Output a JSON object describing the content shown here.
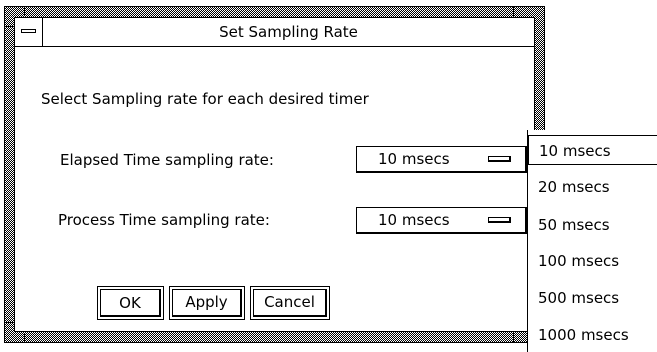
{
  "dialog": {
    "title": "Set Sampling Rate",
    "prompt": "Select Sampling rate for each desired timer"
  },
  "rows": [
    {
      "label": "Elapsed Time sampling rate:",
      "value": "10 msecs"
    },
    {
      "label": "Process Time sampling rate:",
      "value": "10 msecs"
    }
  ],
  "buttons": {
    "ok": "OK",
    "apply": "Apply",
    "cancel": "Cancel"
  },
  "popup": {
    "selected_index": 0,
    "options": [
      "10 msecs",
      "20 msecs",
      "50 msecs",
      "100 msecs",
      "500 msecs",
      "1000 msecs"
    ]
  }
}
